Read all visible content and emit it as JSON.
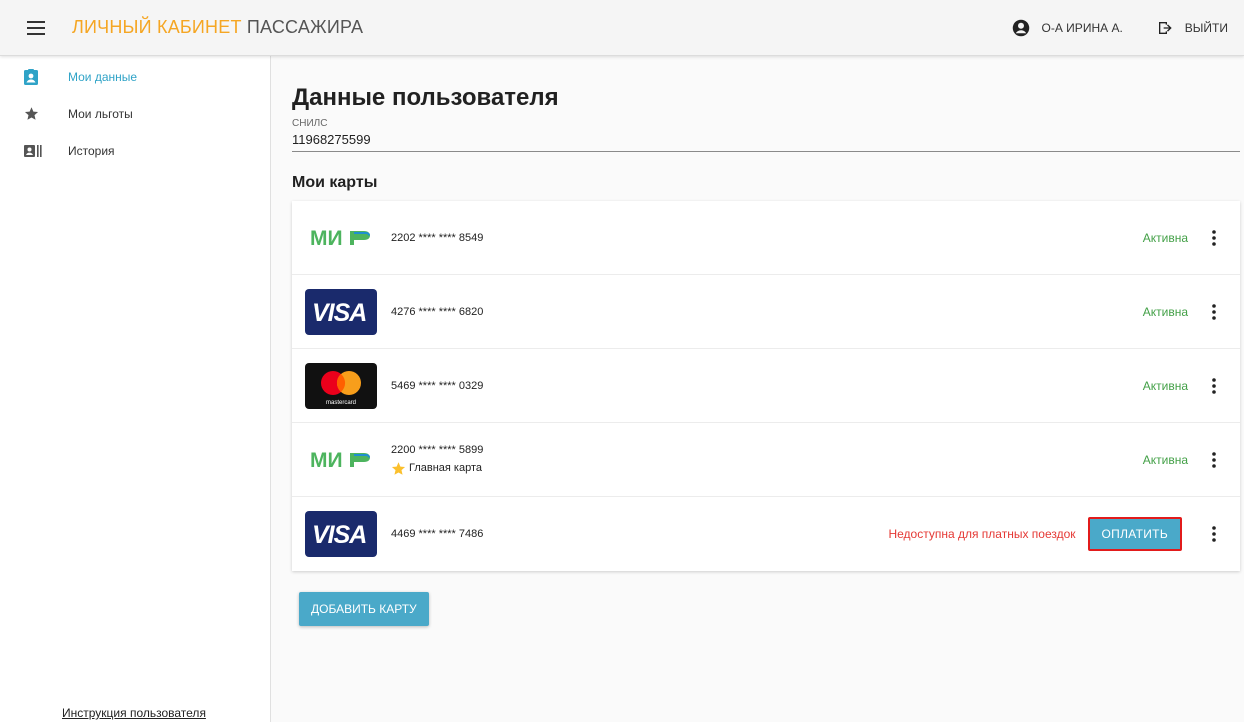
{
  "header": {
    "title_accent": "ЛИЧНЫЙ КАБИНЕТ",
    "title_rest": " ПАССАЖИРА",
    "user_name": "О-А ИРИНА А.",
    "logout_label": "ВЫЙТИ",
    "accent_color": "#f5a623"
  },
  "sidebar": {
    "items": [
      {
        "label": "Мои данные",
        "icon": "account-box-icon",
        "active": true
      },
      {
        "label": "Мои льготы",
        "icon": "star-icon",
        "active": false
      },
      {
        "label": "История",
        "icon": "history-card-icon",
        "active": false
      }
    ],
    "footer_link": "Инструкция пользователя"
  },
  "main": {
    "page_title": "Данные пользователя",
    "snils_label": "СНИЛС",
    "snils_value": "11968275599",
    "cards_title": "Мои карты",
    "cards": [
      {
        "type": "mir",
        "number": "2202 **** **** 8549",
        "status": "Активна"
      },
      {
        "type": "visa",
        "number": "4276 **** **** 6820",
        "status": "Активна"
      },
      {
        "type": "mastercard",
        "number": "5469 **** **** 0329",
        "status": "Активна"
      },
      {
        "type": "mir",
        "number": "2200 **** **** 5899",
        "main_label": "Главная карта",
        "status": "Активна"
      },
      {
        "type": "visa",
        "number": "4469 **** **** 7486",
        "status": "Недоступна для платных поездок",
        "pay_label": "ОПЛАТИТЬ"
      }
    ],
    "add_card_label": "ДОБАВИТЬ КАРТУ",
    "status_active_color": "#43a047",
    "status_error_color": "#e53935",
    "button_color": "#4aa9c9"
  }
}
